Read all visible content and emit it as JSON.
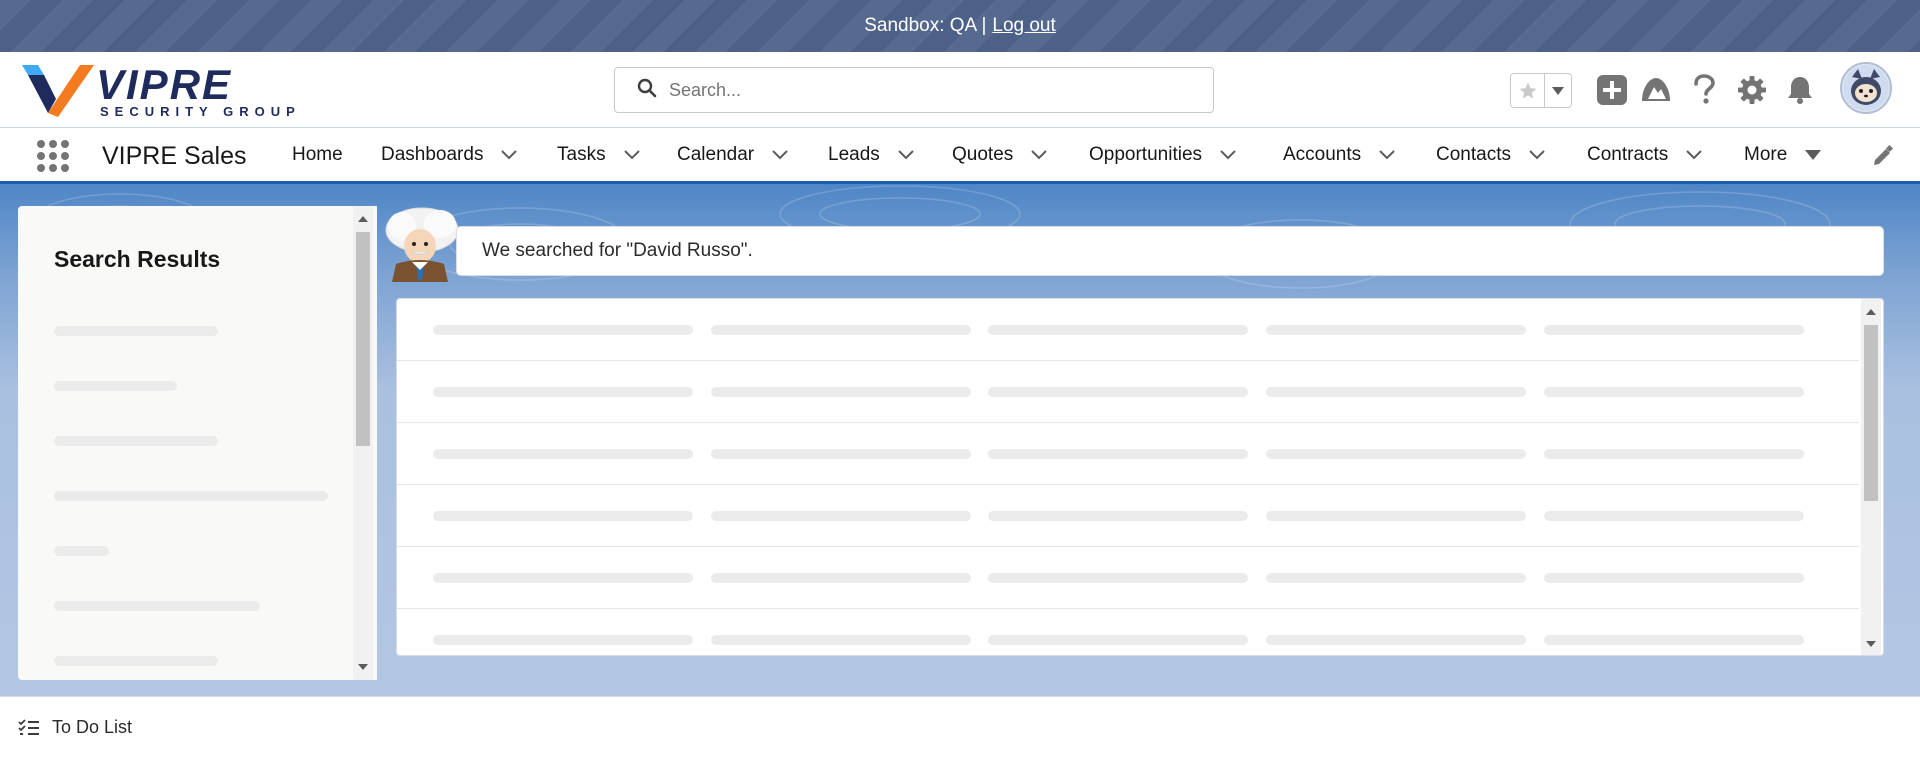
{
  "sandbox_bar": {
    "prefix": "Sandbox: QA |",
    "logout_label": "Log out"
  },
  "header": {
    "logo_main": "VIPRE",
    "logo_sub": "SECURITY GROUP",
    "search_placeholder": "Search...",
    "icons": [
      "star-icon",
      "chevron-down-icon",
      "add-icon",
      "trailhead-icon",
      "help-icon",
      "setup-gear-icon",
      "notification-bell-icon",
      "user-avatar"
    ]
  },
  "nav": {
    "app_name": "VIPRE Sales",
    "items": [
      {
        "label": "Home",
        "has_menu": false
      },
      {
        "label": "Dashboards",
        "has_menu": true
      },
      {
        "label": "Tasks",
        "has_menu": true
      },
      {
        "label": "Calendar",
        "has_menu": true
      },
      {
        "label": "Leads",
        "has_menu": true
      },
      {
        "label": "Quotes",
        "has_menu": true
      },
      {
        "label": "Opportunities",
        "has_menu": true
      },
      {
        "label": "Accounts",
        "has_menu": true
      },
      {
        "label": "Contacts",
        "has_menu": true
      },
      {
        "label": "Contracts",
        "has_menu": true
      },
      {
        "label": "More",
        "has_menu": true
      }
    ]
  },
  "search_results": {
    "title": "Search Results",
    "message": "We searched for \"David Russo\"."
  },
  "utility_bar": {
    "todo_label": "To Do List"
  },
  "colors": {
    "sandbox_bar": "#56698f",
    "brand_blue": "#1b5fb5",
    "logo_navy": "#1e2b5c",
    "logo_orange": "#f47b20",
    "logo_cyan": "#3fa9f5"
  }
}
